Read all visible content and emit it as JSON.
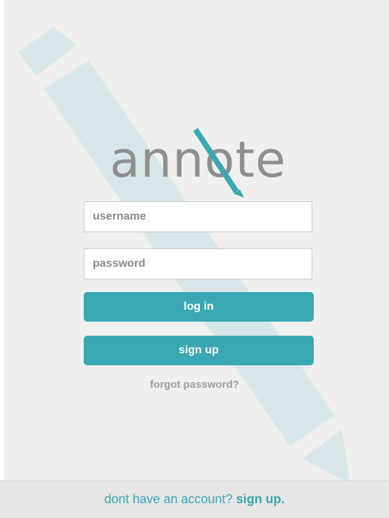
{
  "app": {
    "logo_text": "annote"
  },
  "login_form": {
    "username_placeholder": "username",
    "password_placeholder": "password",
    "login_label": "log in",
    "signup_label": "sign up",
    "forgot_label": "forgot password?"
  },
  "footer": {
    "prompt_text": "dont have an account?",
    "signup_link_label": "sign up."
  },
  "colors": {
    "accent": "#3aa8b3",
    "background": "#efefef",
    "background_pencil": "#d7e6e9",
    "logo_text": "#8f8f8f",
    "footer_bg": "#e6e6e6"
  },
  "icons": {
    "background_graphic": "pencil-icon",
    "logo_graphic": "pencil-icon"
  }
}
